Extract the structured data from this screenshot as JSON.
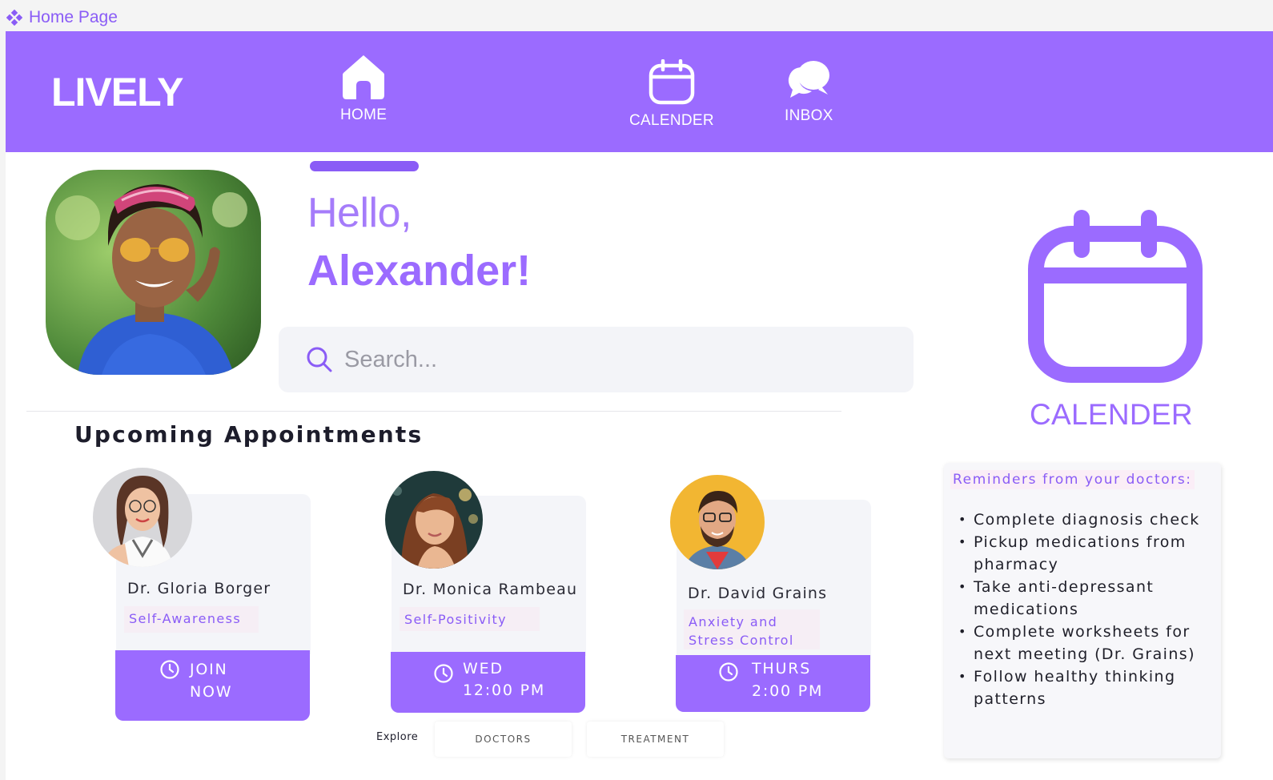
{
  "frame": {
    "label": "Home Page",
    "icon": "component-diamond-icon"
  },
  "nav": {
    "brand": "LIVELY",
    "items": [
      {
        "label": "HOME",
        "icon": "home-icon",
        "active": true
      },
      {
        "label": "CALENDER",
        "icon": "calendar-icon",
        "active": false
      },
      {
        "label": "INBOX",
        "icon": "chat-bubbles-icon",
        "active": false
      }
    ]
  },
  "greeting": {
    "hello": "Hello,",
    "name": "Alexander!"
  },
  "search": {
    "placeholder": "Search...",
    "value": ""
  },
  "appointments": {
    "title": "Upcoming Appointments",
    "items": [
      {
        "doctor": "Dr. Gloria Borger",
        "tag": "Self-Awareness",
        "line1": "JOIN",
        "line2": "NOW"
      },
      {
        "doctor": "Dr. Monica Rambeau",
        "tag": "Self-Positivity",
        "line1": "WED",
        "line2": "12:00 PM"
      },
      {
        "doctor": "Dr. David Grains",
        "tag": "Anxiety and Stress Control",
        "line1": "THURS",
        "line2": "2:00 PM"
      }
    ]
  },
  "explore": {
    "label": "Explore",
    "doctors": "DOCTORS",
    "treatment": "TREATMENT"
  },
  "calendar_widget": {
    "label": "CALENDER",
    "icon": "calendar-icon"
  },
  "reminders": {
    "title": "Reminders from your doctors:",
    "items": [
      "Complete diagnosis check",
      "Pickup medications from pharmacy",
      "Take anti-depressant medications",
      "Complete worksheets for next meeting (Dr. Grains)",
      "Follow healthy thinking patterns"
    ]
  },
  "colors": {
    "accent": "#9b6bff",
    "accent_dark": "#8a5cf6",
    "tag_bg": "#f6eef5",
    "card_bg": "#f4f5f9"
  }
}
